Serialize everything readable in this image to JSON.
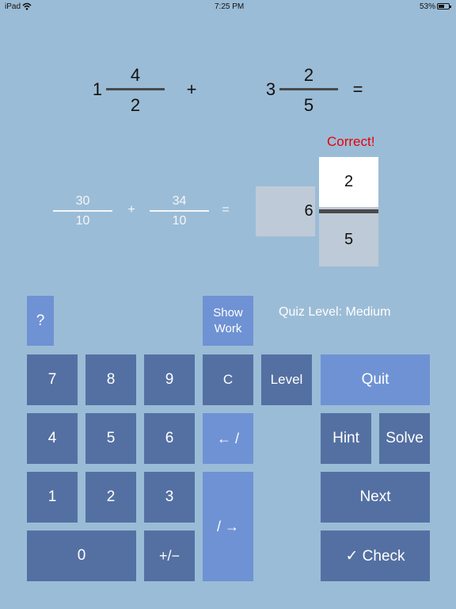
{
  "status_bar": {
    "device": "iPad",
    "time": "7:25 PM",
    "battery": "53%"
  },
  "problem": {
    "left": {
      "whole": "1",
      "numerator": "4",
      "denominator": "2"
    },
    "operator": "+",
    "right": {
      "whole": "3",
      "numerator": "2",
      "denominator": "5"
    },
    "equals": "="
  },
  "feedback": "Correct!",
  "work": {
    "left": {
      "numerator": "30",
      "denominator": "10"
    },
    "operator": "+",
    "right": {
      "numerator": "34",
      "denominator": "10"
    },
    "equals": "="
  },
  "answer": {
    "whole": "6",
    "numerator": "2",
    "denominator": "5"
  },
  "controls": {
    "help": "?",
    "show_work_line1": "Show",
    "show_work_line2": "Work",
    "quiz_level": "Quiz Level: Medium"
  },
  "keypad": {
    "k7": "7",
    "k8": "8",
    "k9": "9",
    "clear": "C",
    "level": "Level",
    "quit": "Quit",
    "k4": "4",
    "k5": "5",
    "k6": "6",
    "back_slash": "← /",
    "hint": "Hint",
    "solve": "Solve",
    "k1": "1",
    "k2": "2",
    "k3": "3",
    "slash_forward": "/ →",
    "next": "Next",
    "k0": "0",
    "plus_minus": "+/−",
    "check": "✓ Check"
  }
}
